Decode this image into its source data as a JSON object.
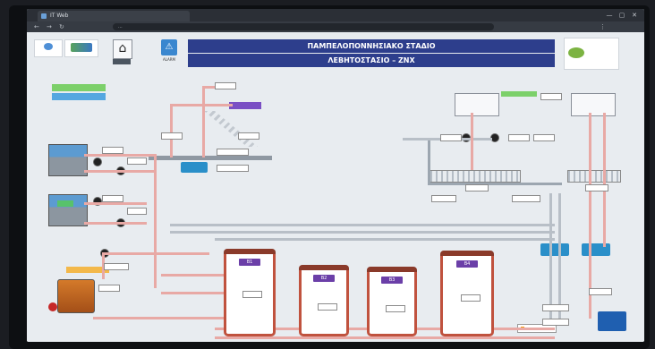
{
  "browser": {
    "tab_title": "IT Web",
    "url": "...",
    "controls": [
      "—",
      "▢",
      "✕"
    ]
  },
  "header": {
    "title_line1": "ΠΑΜΠΕΛΟΠΟΝΝΗΣΙΑΚΟ ΣΤΑΔΙΟ",
    "title_line2": "ΛΕΒΗΤΟΣΤΑΣΙΟ – ΖΝΧ",
    "home_label": "",
    "alarm_label": "ALARM"
  },
  "tanks": [
    {
      "label": "B1"
    },
    {
      "label": "B2"
    },
    {
      "label": "B3"
    },
    {
      "label": "B4"
    }
  ],
  "colors": {
    "header_bg": "#2d3e8c",
    "pipe_hot": "#e8a9a5",
    "pipe_cold": "#b8bfc7",
    "tank_border": "#c0523e",
    "tank_label": "#6b3fa8",
    "panel_blue": "#2a8fc9"
  }
}
